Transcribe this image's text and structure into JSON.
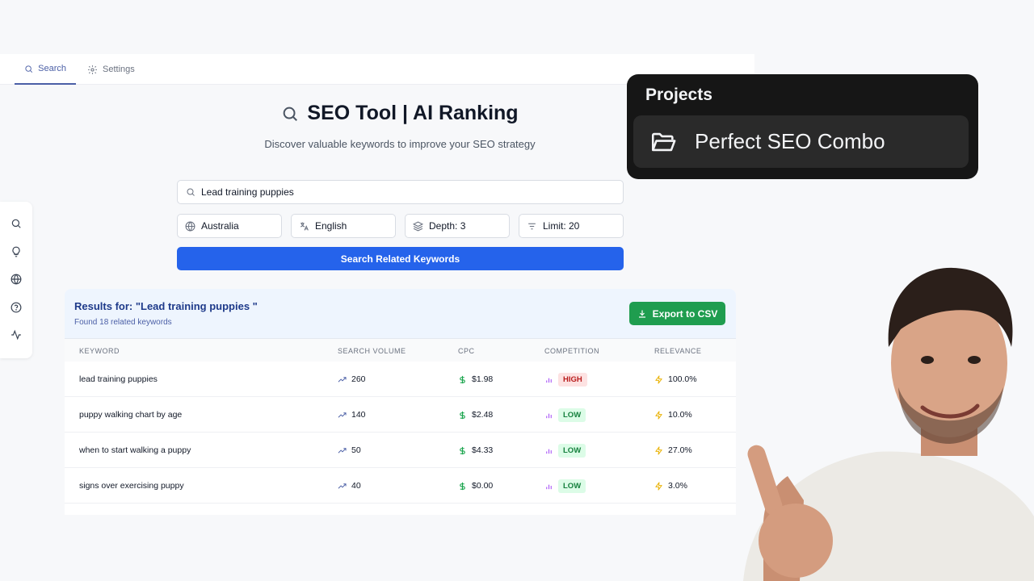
{
  "tabs": [
    {
      "label": "Search",
      "icon": "search-icon",
      "active": true
    },
    {
      "label": "Settings",
      "icon": "gear-icon",
      "active": false
    }
  ],
  "sidebar": {
    "icons": [
      "search-icon",
      "lightbulb-icon",
      "globe-icon",
      "help-circle-icon",
      "activity-icon"
    ]
  },
  "hero": {
    "title": "SEO Tool | AI Ranking",
    "subtitle": "Discover valuable keywords to improve your SEO strategy"
  },
  "search": {
    "value": "Lead training puppies",
    "country": "Australia",
    "language": "English",
    "depth": "Depth: 3",
    "limit": "Limit: 20",
    "button_label": "Search Related Keywords"
  },
  "results": {
    "title": "Results for: \"Lead training puppies \"",
    "count": "Found 18 related keywords",
    "export_label": "Export to CSV",
    "columns": [
      "KEYWORD",
      "SEARCH VOLUME",
      "CPC",
      "COMPETITION",
      "RELEVANCE"
    ],
    "rows": [
      {
        "keyword": "lead training puppies",
        "volume": "260",
        "cpc": "$1.98",
        "competition": "HIGH",
        "relevance": "100.0%"
      },
      {
        "keyword": "puppy walking chart by age",
        "volume": "140",
        "cpc": "$2.48",
        "competition": "LOW",
        "relevance": "10.0%"
      },
      {
        "keyword": "when to start walking a puppy",
        "volume": "50",
        "cpc": "$4.33",
        "competition": "LOW",
        "relevance": "27.0%"
      },
      {
        "keyword": "signs over exercising puppy",
        "volume": "40",
        "cpc": "$0.00",
        "competition": "LOW",
        "relevance": "3.0%"
      }
    ]
  },
  "projects": {
    "title": "Projects",
    "item": "Perfect SEO Combo"
  },
  "colors": {
    "primary": "#2563eb",
    "export": "#1f9d4f",
    "high": "#b91c1c",
    "low": "#15803d"
  }
}
